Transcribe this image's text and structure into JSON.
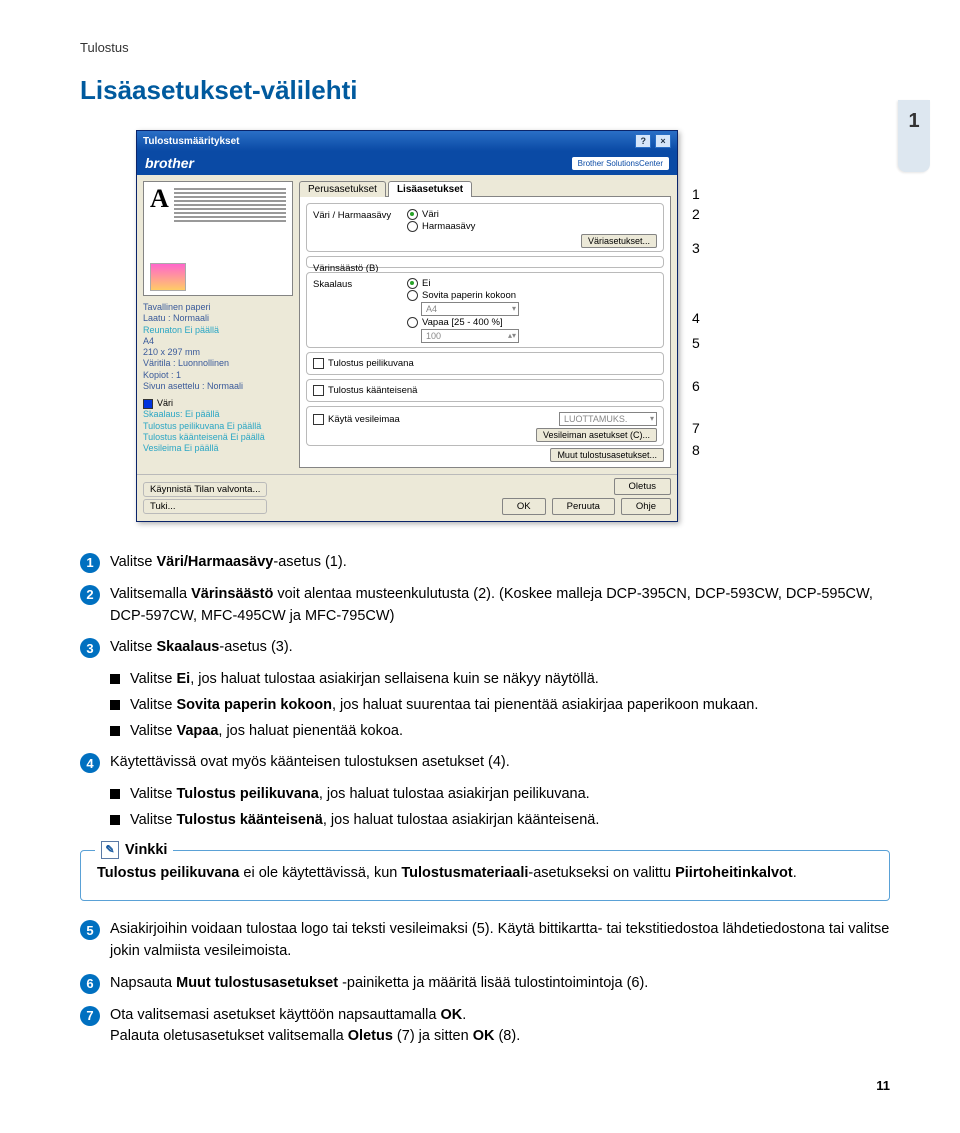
{
  "header_section": "Tulostus",
  "page_title": "Lisäasetukset-välilehti",
  "side_tab": "1",
  "page_number": "11",
  "dialog": {
    "title": "Tulostusmääritykset",
    "brand": "brother",
    "solution_center": "Brother SolutionsCenter",
    "tabs": {
      "basic": "Perusasetukset",
      "advanced": "Lisäasetukset"
    },
    "preview_letter": "A",
    "preview_info": {
      "l1": "Tavallinen paperi",
      "l2": "Laatu : Normaali",
      "l3": "Reunaton  Ei päällä",
      "l4": "A4",
      "l5": "210 x 297 mm",
      "l6": "Väritila : Luonnollinen",
      "l7": "Kopiot : 1",
      "l8": "Sivun asettelu : Normaali",
      "vari": "Väri",
      "s1": "Skaalaus: Ei päällä",
      "s2": "Tulostus peilikuvana Ei päällä",
      "s3": "Tulostus käänteisenä Ei päällä",
      "s4": "Vesileima Ei päällä"
    },
    "group1": {
      "label": "Väri / Harmaasävy",
      "opt1": "Väri",
      "opt2": "Harmaasävy",
      "btn": "Väriasetukset..."
    },
    "group2": {
      "label": "Värinsäästö (B)"
    },
    "group3": {
      "label": "Skaalaus",
      "opt1": "Ei",
      "opt2": "Sovita paperin kokoon",
      "size": "A4",
      "opt3": "Vapaa [25 - 400 %]",
      "perc": "100"
    },
    "chk1": "Tulostus peilikuvana",
    "chk2": "Tulostus käänteisenä",
    "chk3_label": "Käytä vesileimaa",
    "chk3_field": "LUOTTAMUKS.",
    "chk3_btn": "Vesileiman asetukset (C)...",
    "more_btn": "Muut tulostusasetukset...",
    "bottom": {
      "b1": "Käynnistä Tilan valvonta...",
      "b2": "Tuki...",
      "oletus": "Oletus",
      "ok": "OK",
      "peruuta": "Peruuta",
      "ohje": "Ohje"
    }
  },
  "callouts": {
    "c1": "1",
    "c2": "2",
    "c3": "3",
    "c4": "4",
    "c5": "5",
    "c6": "6",
    "c7": "7",
    "c8": "8"
  },
  "instructions": {
    "i1": {
      "pre": "Valitse ",
      "b": "Väri/Harmaasävy",
      "post": "-asetus (1)."
    },
    "i2": {
      "pre": "Valitsemalla ",
      "b": "Värinsäästö",
      "mid": " voit alentaa musteenkulutusta (2). (Koskee malleja DCP-395CN, DCP-593CW, DCP-595CW, DCP-597CW, MFC-495CW ja MFC-795CW)"
    },
    "i3": {
      "pre": "Valitse ",
      "b": "Skaalaus",
      "post": "-asetus (3).",
      "s1": {
        "pre": "Valitse ",
        "b": "Ei",
        "post": ", jos haluat tulostaa asiakirjan sellaisena kuin se näkyy näytöllä."
      },
      "s2": {
        "pre": "Valitse ",
        "b": "Sovita paperin kokoon",
        "post": ", jos haluat suurentaa tai pienentää asiakirjaa paperikoon mukaan."
      },
      "s3": {
        "pre": "Valitse ",
        "b": "Vapaa",
        "post": ", jos haluat pienentää kokoa."
      }
    },
    "i4": {
      "text": "Käytettävissä ovat myös käänteisen tulostuksen asetukset (4).",
      "s1": {
        "pre": "Valitse ",
        "b": "Tulostus peilikuvana",
        "post": ", jos haluat tulostaa asiakirjan peilikuvana."
      },
      "s2": {
        "pre": "Valitse ",
        "b": "Tulostus käänteisenä",
        "post": ", jos haluat tulostaa asiakirjan käänteisenä."
      }
    },
    "vinkki_head": "Vinkki",
    "vinkki": {
      "b1": "Tulostus peilikuvana",
      "t1": " ei ole käytettävissä, kun ",
      "b2": "Tulostusmateriaali",
      "t2": "-asetukseksi on valittu ",
      "b3": "Piirtoheitinkalvot",
      "t3": "."
    },
    "i5": "Asiakirjoihin voidaan tulostaa logo tai teksti vesileimaksi (5). Käytä bittikartta- tai tekstitiedostoa lähdetiedostona tai valitse jokin valmiista vesileimoista.",
    "i6": {
      "pre": "Napsauta ",
      "b": "Muut tulostusasetukset",
      "post": " -painiketta ja määritä lisää tulostintoimintoja (6)."
    },
    "i7": {
      "l1_pre": "Ota valitsemasi asetukset käyttöön napsauttamalla ",
      "l1_b": "OK",
      "l1_post": ".",
      "l2_pre": "Palauta oletusasetukset valitsemalla ",
      "l2_b1": "Oletus",
      "l2_mid": " (7) ja sitten ",
      "l2_b2": "OK",
      "l2_post": " (8)."
    }
  }
}
